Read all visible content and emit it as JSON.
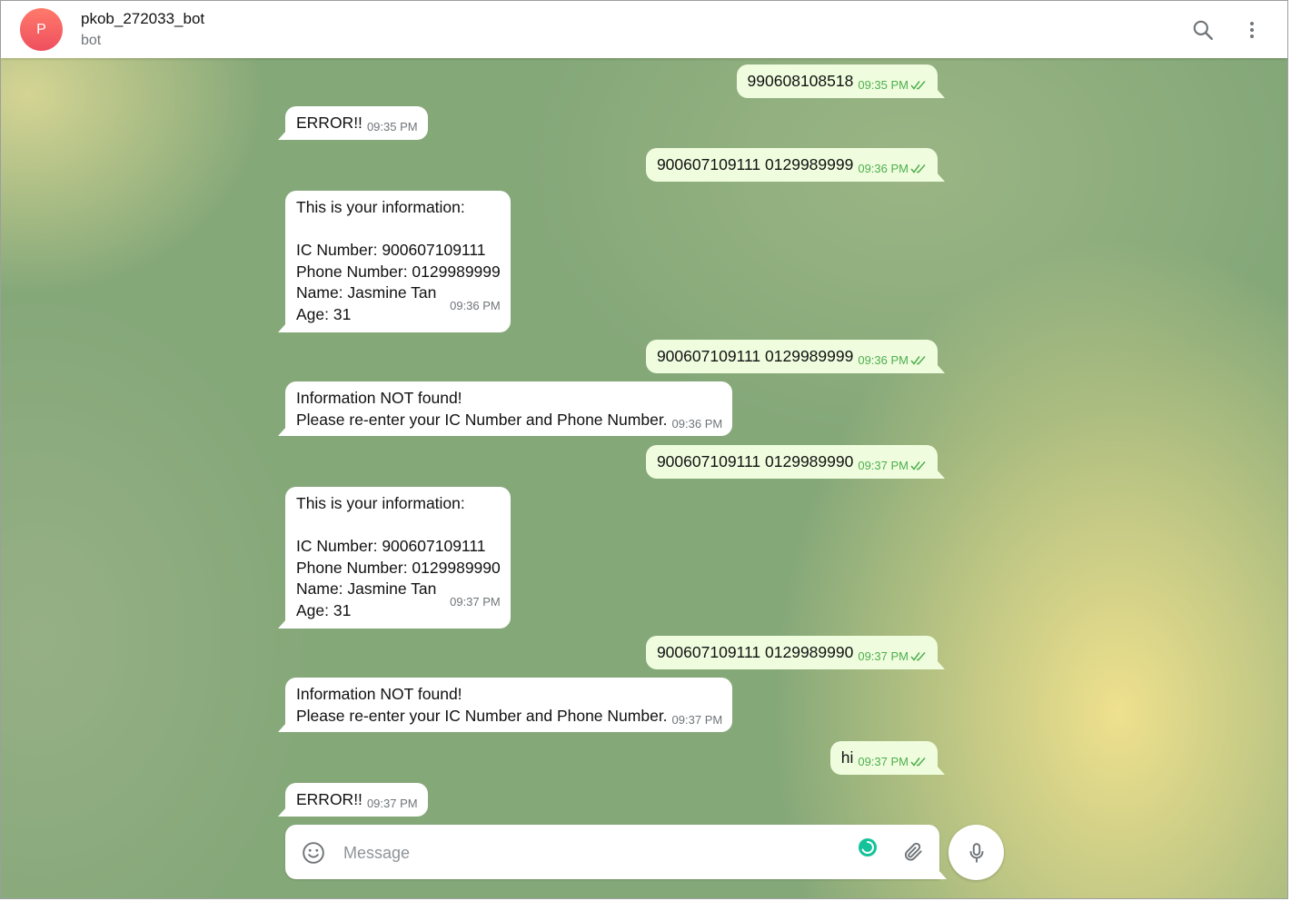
{
  "header": {
    "avatar_letter": "P",
    "title": "pkob_272033_bot",
    "subtitle": "bot"
  },
  "colors": {
    "accent": "#4fae4e",
    "outgoing_bubble": "#effdde",
    "incoming_bubble": "#ffffff",
    "avatar": "#ef5b63"
  },
  "messages": [
    {
      "dir": "out",
      "text": "990608108518",
      "time": "09:35 PM",
      "status": "read"
    },
    {
      "dir": "in",
      "text": "ERROR!!",
      "time": "09:35 PM"
    },
    {
      "dir": "out",
      "text": "900607109111 0129989999",
      "time": "09:36 PM",
      "status": "read"
    },
    {
      "dir": "in",
      "text": "This is your information:\n\nIC Number: 900607109111\nPhone Number: 0129989999\nName: Jasmine Tan\nAge: 31",
      "time": "09:36 PM"
    },
    {
      "dir": "out",
      "text": "900607109111 0129989999",
      "time": "09:36 PM",
      "status": "read"
    },
    {
      "dir": "in",
      "text": "Information NOT found!\nPlease re-enter your IC Number and Phone Number.",
      "time": "09:36 PM"
    },
    {
      "dir": "out",
      "text": "900607109111 0129989990",
      "time": "09:37 PM",
      "status": "read"
    },
    {
      "dir": "in",
      "text": "This is your information:\n\nIC Number: 900607109111\nPhone Number: 0129989990\nName: Jasmine Tan\nAge: 31",
      "time": "09:37 PM"
    },
    {
      "dir": "out",
      "text": "900607109111 0129989990",
      "time": "09:37 PM",
      "status": "read"
    },
    {
      "dir": "in",
      "text": "Information NOT found!\nPlease re-enter your IC Number and Phone Number.",
      "time": "09:37 PM"
    },
    {
      "dir": "out",
      "text": "hi",
      "time": "09:37 PM",
      "status": "read"
    },
    {
      "dir": "in",
      "text": "ERROR!!",
      "time": "09:37 PM"
    }
  ],
  "composer": {
    "placeholder": "Message",
    "value": ""
  },
  "icons": {
    "search": "search-icon",
    "more": "more-vertical-icon",
    "emoji": "emoji-icon",
    "attach": "paperclip-icon",
    "mic": "microphone-icon",
    "read": "double-check-icon"
  }
}
